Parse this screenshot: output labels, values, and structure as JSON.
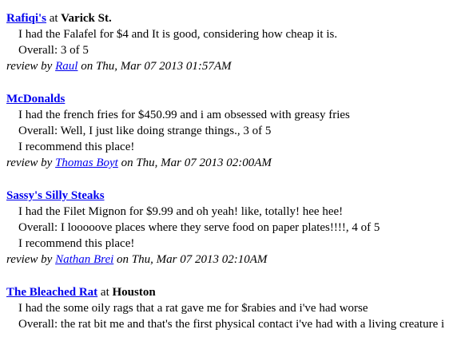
{
  "reviews": [
    {
      "restaurant": "Rafiqi's",
      "at_word": "at",
      "location": "Varick St.",
      "body": "I had the Falafel for $4 and It is good, considering how cheap it is.",
      "overall": "Overall: 3 of 5",
      "recommend": "",
      "byline_prefix": "review by",
      "reviewer": "Raul",
      "date": "on Thu, Mar 07 2013 01:57AM"
    },
    {
      "restaurant": "McDonalds",
      "at_word": "",
      "location": "",
      "body": "I had the french fries for $450.99 and i am obsessed with greasy fries",
      "overall": "Overall: Well, I just like doing strange things., 3 of 5",
      "recommend": "I recommend this place!",
      "byline_prefix": "review by",
      "reviewer": "Thomas Boyt",
      "date": "on Thu, Mar 07 2013 02:00AM"
    },
    {
      "restaurant": "Sassy's Silly Steaks",
      "at_word": "",
      "location": "",
      "body": "I had the Filet Mignon for $9.99 and oh yeah! like, totally! hee hee!",
      "overall": "Overall: I looooove places where they serve food on paper plates!!!!, 4 of 5",
      "recommend": "I recommend this place!",
      "byline_prefix": "review by",
      "reviewer": "Nathan Brei",
      "date": "on Thu, Mar 07 2013 02:10AM"
    },
    {
      "restaurant": "The Bleached Rat",
      "at_word": "at",
      "location": "Houston",
      "body": "I had the some oily rags that a rat gave me for $rabies and i've had worse",
      "overall": "Overall: the rat bit me and that's the first physical contact i've had with a living creature i"
    }
  ]
}
